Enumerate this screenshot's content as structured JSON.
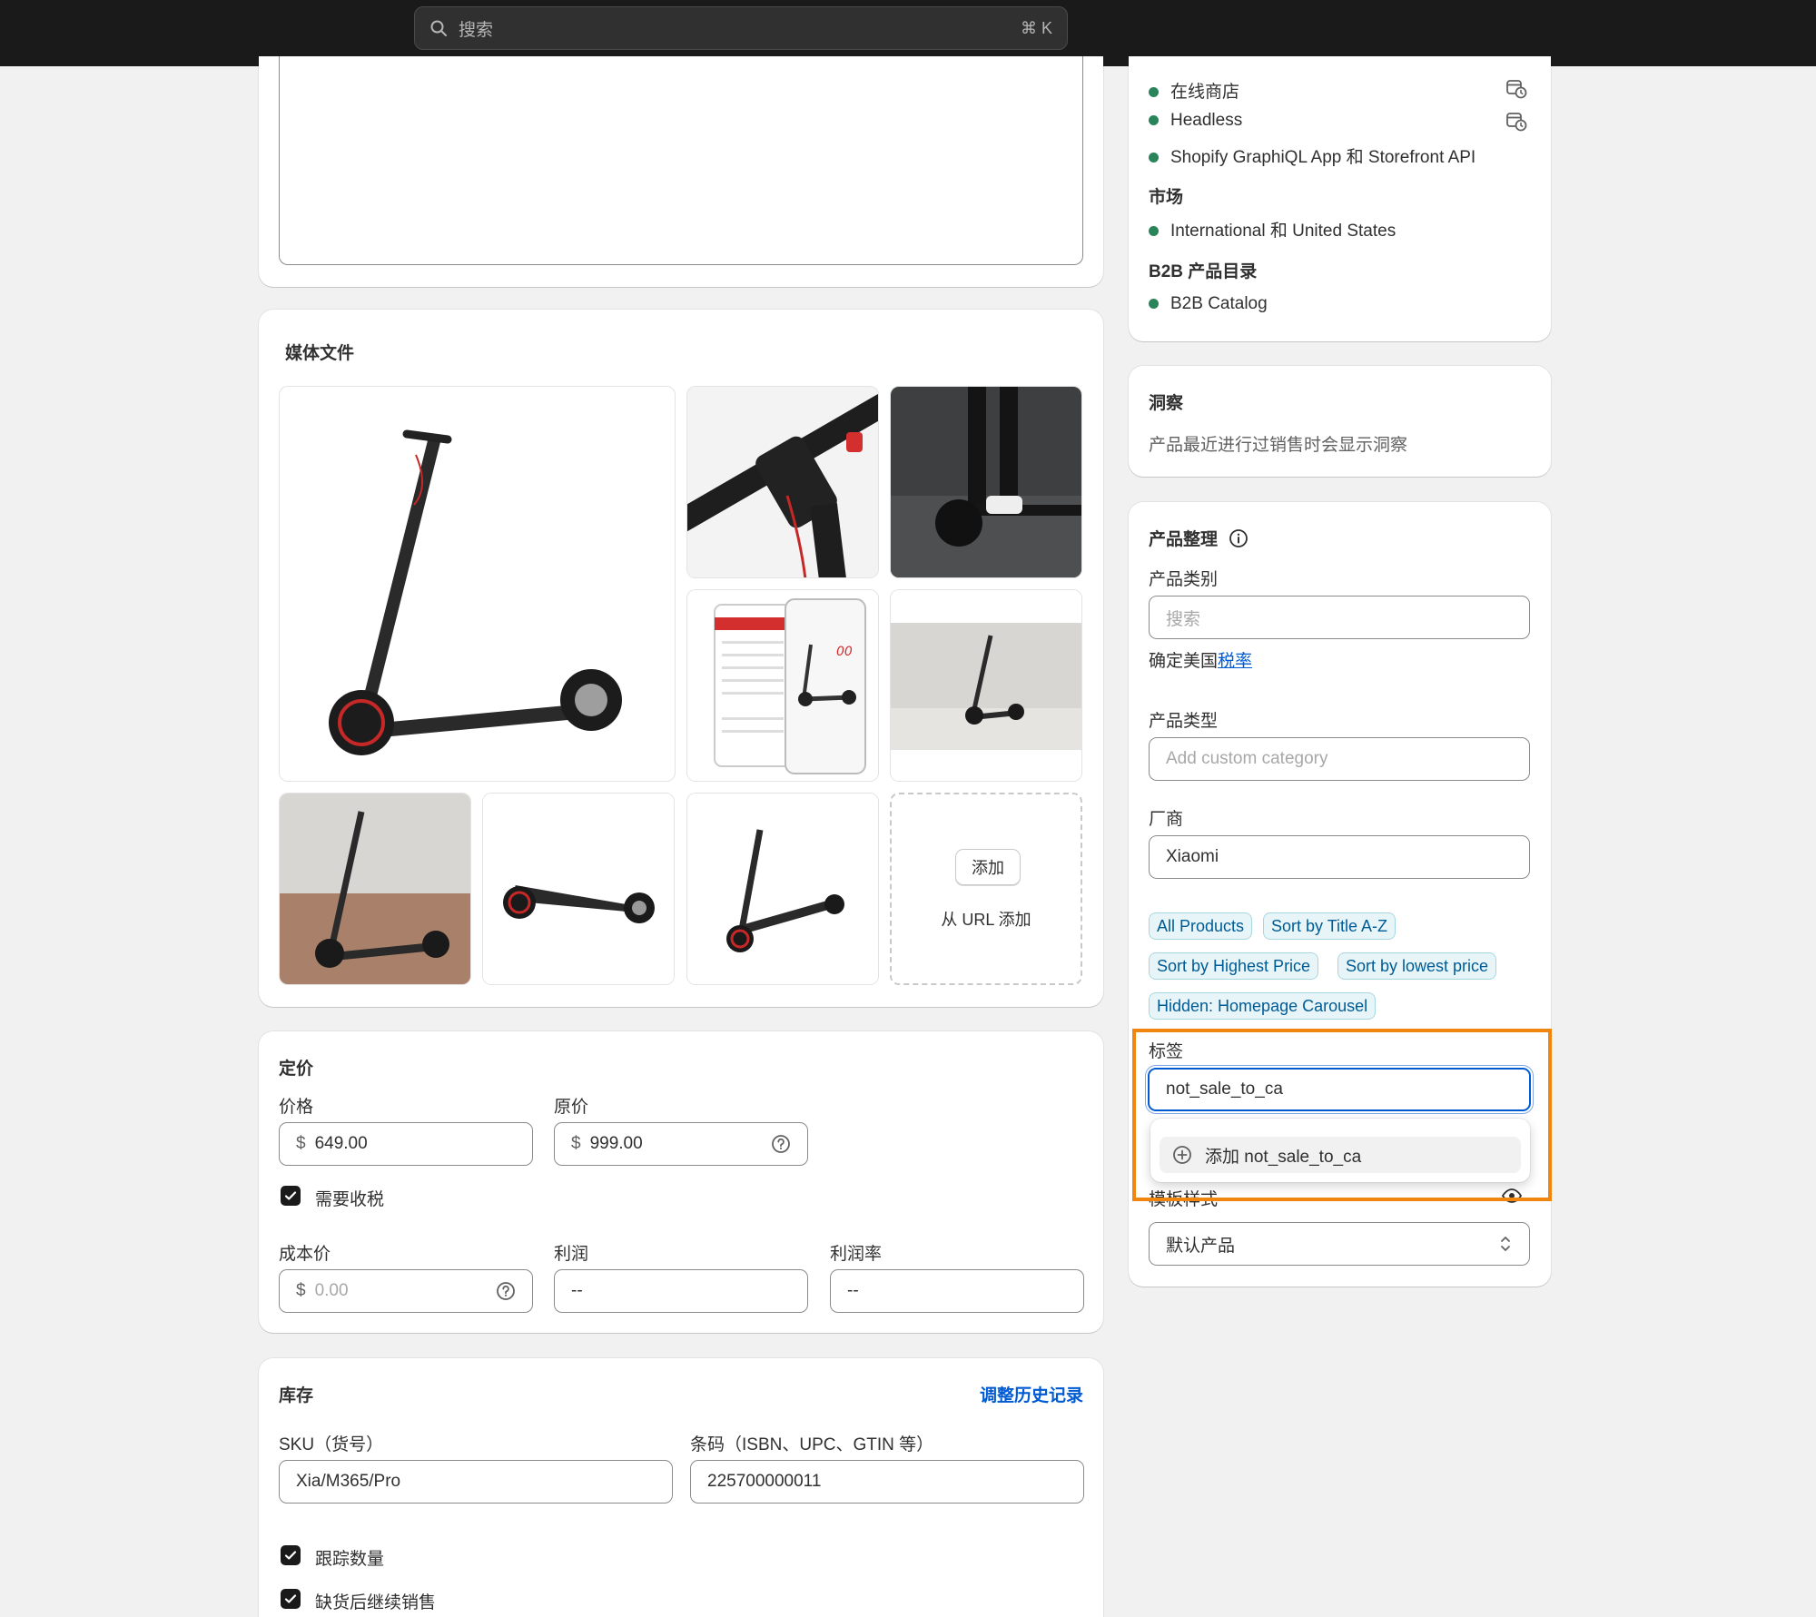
{
  "topbar": {
    "search_placeholder": "搜索",
    "shortcut": "⌘ K"
  },
  "sales_channels": {
    "items": [
      "在线商店",
      "Headless",
      "Shopify GraphiQL App 和 Storefront API"
    ],
    "markets_title": "市场",
    "markets_value": "International 和 United States",
    "b2b_title": "B2B 产品目录",
    "b2b_value": "B2B Catalog"
  },
  "insights": {
    "title": "洞察",
    "text": "产品最近进行过销售时会显示洞察"
  },
  "organization": {
    "title": "产品整理",
    "category_label": "产品类别",
    "category_placeholder": "搜索",
    "tax_prefix": "确定美国",
    "tax_link": "税率",
    "type_label": "产品类型",
    "type_placeholder": "Add custom category",
    "vendor_label": "厂商",
    "vendor_value": "Xiaomi",
    "collections": [
      "All Products",
      "Sort by Title A-Z",
      "Sort by Highest Price",
      "Sort by lowest price",
      "Hidden: Homepage Carousel"
    ],
    "tags_label": "标签",
    "tags_value": "not_sale_to_ca",
    "dropdown_add": "添加 not_sale_to_ca",
    "template_label": "模板样式",
    "template_value": "默认产品"
  },
  "media": {
    "title": "媒体文件",
    "add_button": "添加",
    "add_url": "从 URL 添加"
  },
  "pricing": {
    "title": "定价",
    "price_label": "价格",
    "price_currency": "$",
    "price_value": "649.00",
    "compare_label": "原价",
    "compare_currency": "$",
    "compare_value": "999.00",
    "tax_checkbox": "需要收税",
    "cost_label": "成本价",
    "cost_currency": "$",
    "cost_placeholder": "0.00",
    "profit_label": "利润",
    "profit_value": "--",
    "margin_label": "利润率",
    "margin_value": "--"
  },
  "inventory": {
    "title": "库存",
    "history_link": "调整历史记录",
    "sku_label": "SKU（货号）",
    "sku_value": "Xia/M365/Pro",
    "barcode_label": "条码（ISBN、UPC、GTIN 等）",
    "barcode_value": "225700000011",
    "track_checkbox": "跟踪数量",
    "continue_checkbox": "缺货后继续销售"
  },
  "colors": {
    "highlight": "#f0860f",
    "focus": "#005bd3",
    "link": "#005bd3",
    "status_green": "#29845a"
  }
}
